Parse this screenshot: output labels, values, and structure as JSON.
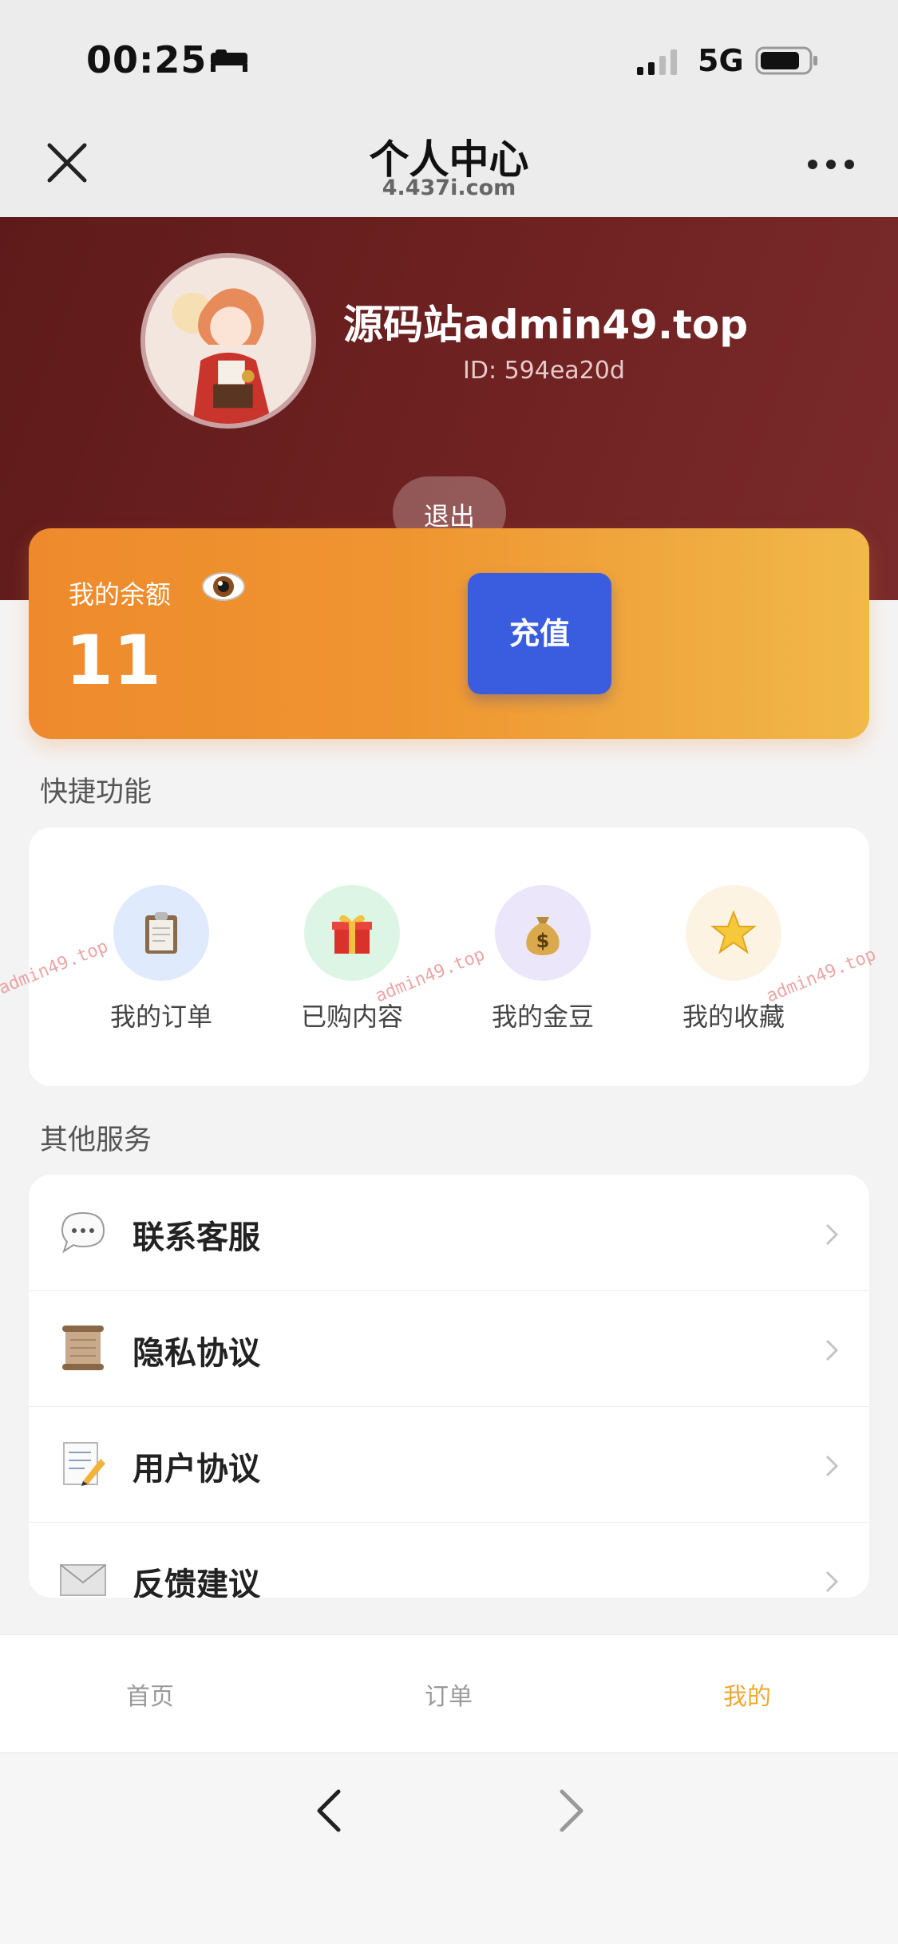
{
  "status_bar": {
    "time": "00:25",
    "network": "5G"
  },
  "nav": {
    "title": "个人中心",
    "subtitle": "4.437i.com"
  },
  "profile": {
    "name": "源码站admin49.top",
    "id": "ID: 594ea20d",
    "logout": "退出"
  },
  "balance": {
    "label": "我的余额",
    "value": "11",
    "recharge": "充值"
  },
  "quick": {
    "title": "快捷功能",
    "items": [
      {
        "label": "我的订单",
        "icon": "clipboard-icon",
        "bg": "#dfeafc"
      },
      {
        "label": "已购内容",
        "icon": "gift-icon",
        "bg": "#dcf5e4"
      },
      {
        "label": "我的金豆",
        "icon": "money-bag-icon",
        "bg": "#ece6fb"
      },
      {
        "label": "我的收藏",
        "icon": "star-icon",
        "bg": "#fdf3e3"
      }
    ]
  },
  "watermark": "admin49.top",
  "services": {
    "title": "其他服务",
    "items": [
      {
        "label": "联系客服",
        "icon": "speech-bubble-icon"
      },
      {
        "label": "隐私协议",
        "icon": "scroll-icon"
      },
      {
        "label": "用户协议",
        "icon": "memo-icon"
      },
      {
        "label": "反馈建议",
        "icon": "envelope-icon"
      }
    ]
  },
  "tabs": [
    {
      "label": "首页",
      "active": false
    },
    {
      "label": "订单",
      "active": false
    },
    {
      "label": "我的",
      "active": true
    }
  ],
  "colors": {
    "accent": "#f0a832",
    "header": "#6b1f1f",
    "recharge": "#3a5de0"
  }
}
